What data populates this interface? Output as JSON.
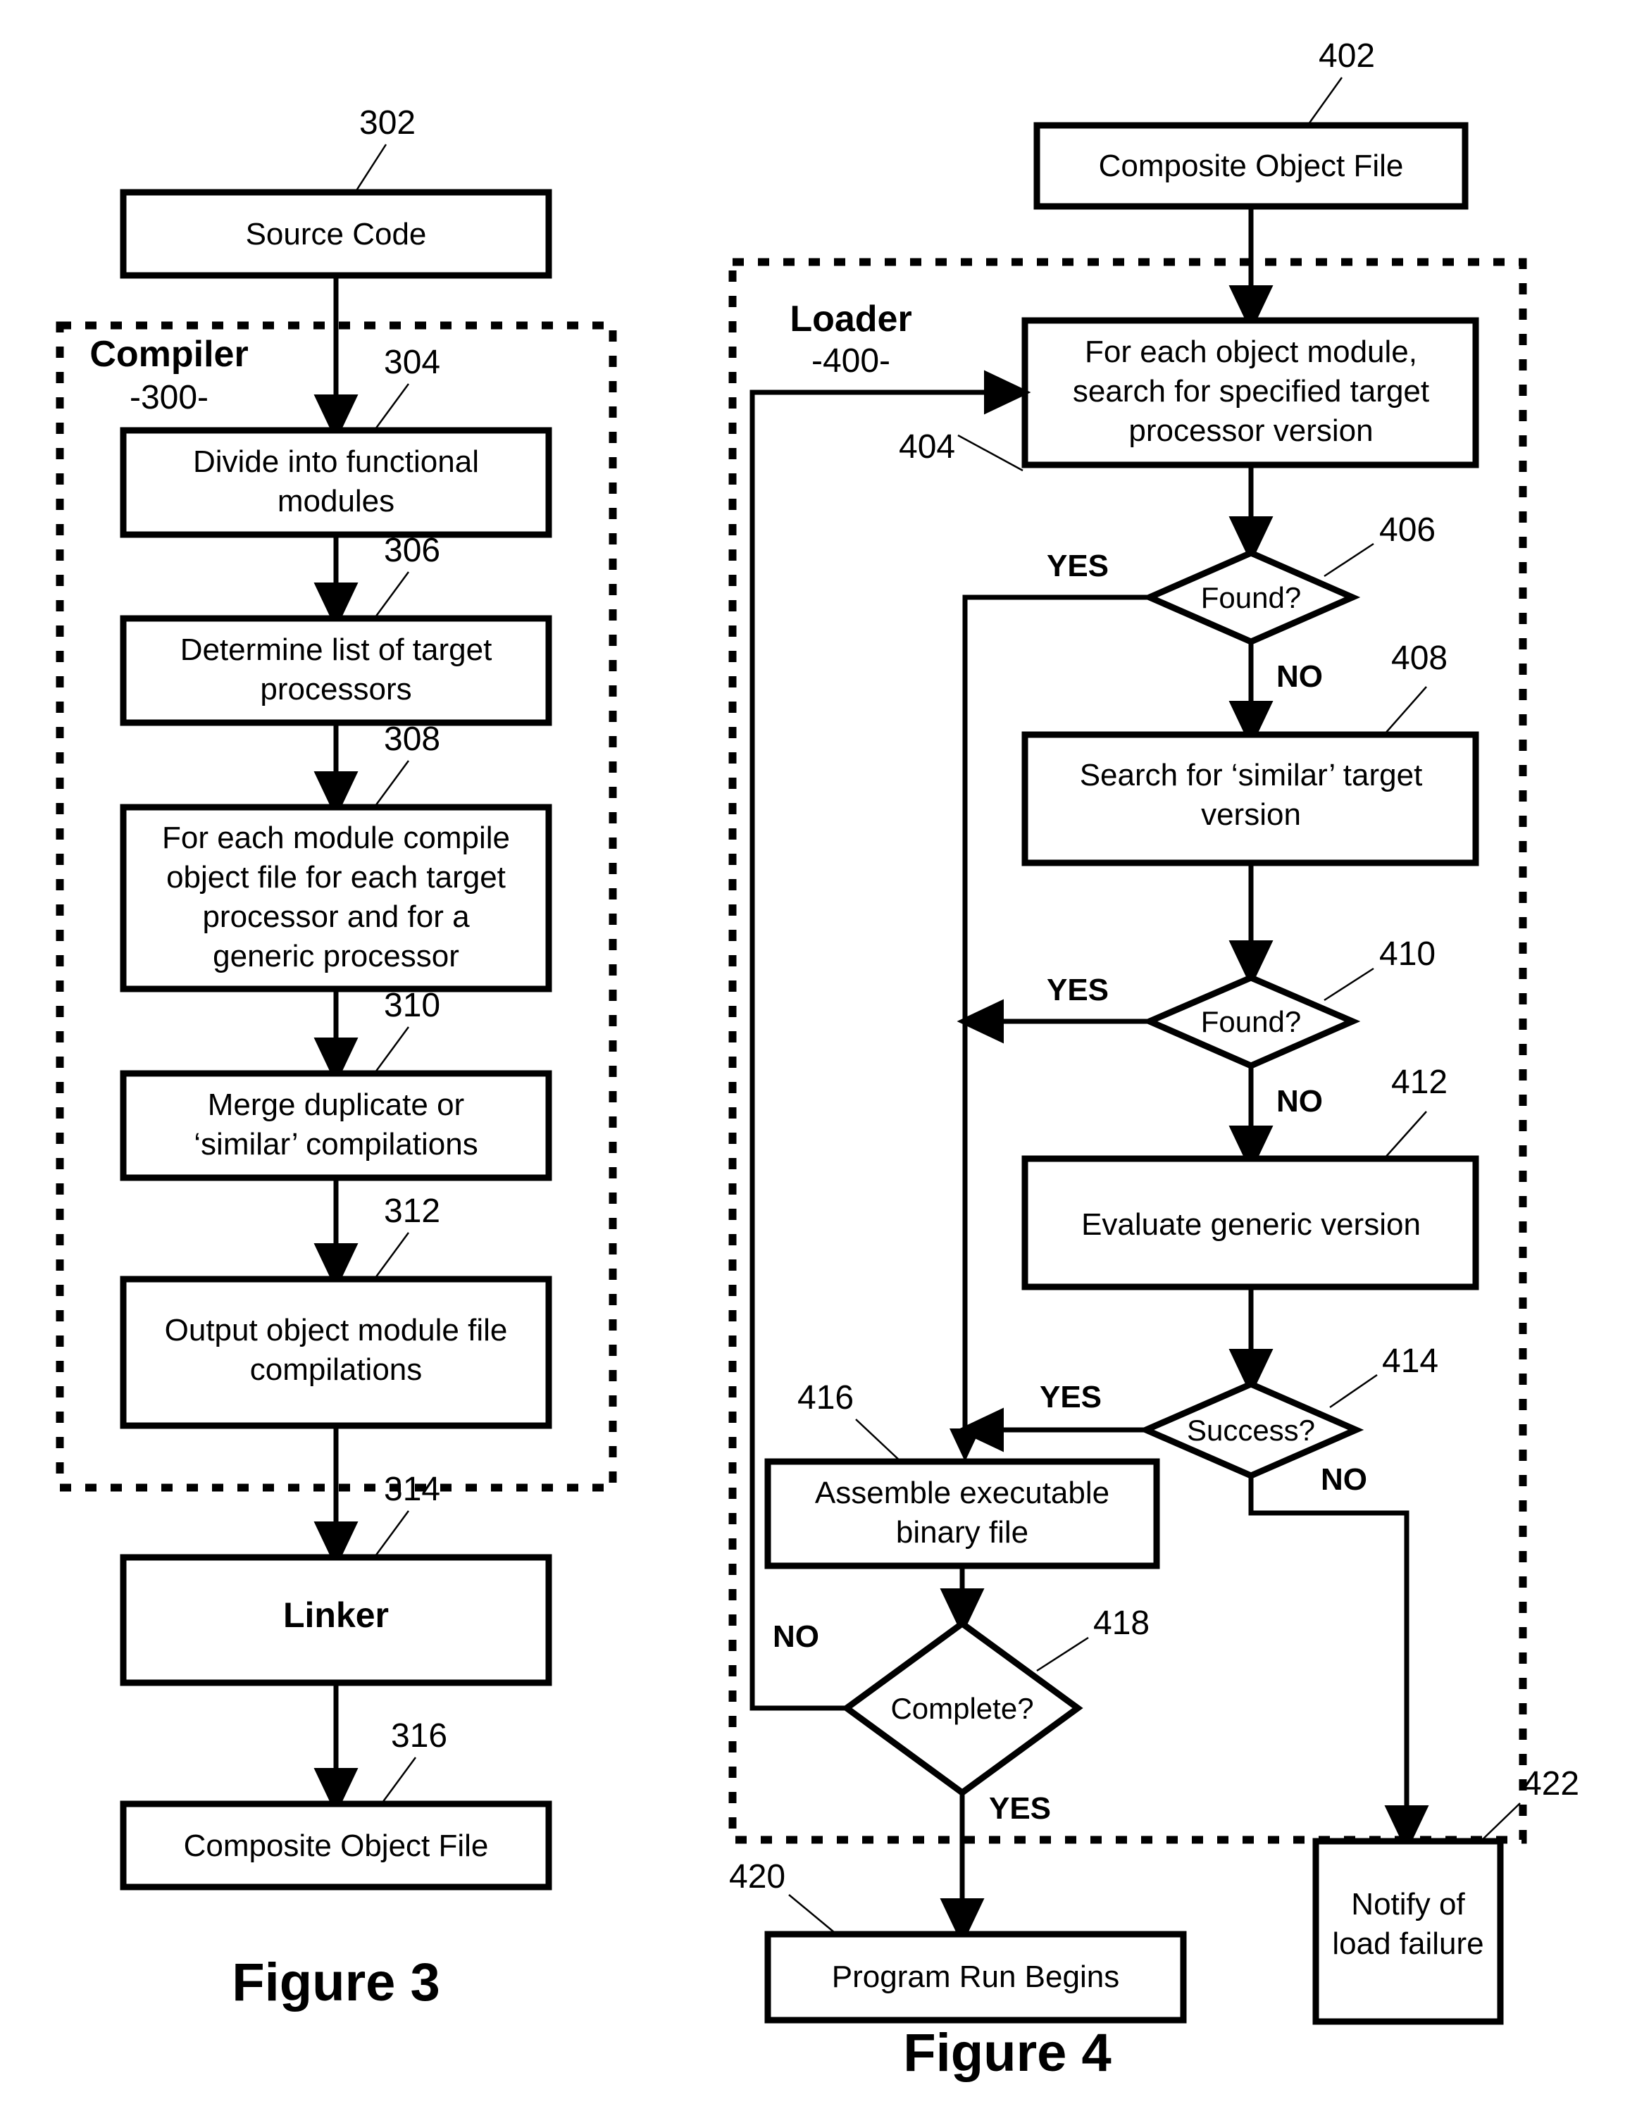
{
  "sheet": {
    "background_color": "#ffffff",
    "ink_color": "#000000"
  },
  "figure3": {
    "caption": "Figure 3",
    "group": {
      "title": "Compiler",
      "number": "-300-"
    },
    "nodes": [
      {
        "ref": "302",
        "label": "Source Code",
        "shape": "box",
        "bold": false
      },
      {
        "ref": "304",
        "label_line1": "Divide into functional",
        "label_line2": "modules",
        "shape": "box",
        "bold": false
      },
      {
        "ref": "306",
        "label_line1": "Determine list of target",
        "label_line2": "processors",
        "shape": "box",
        "bold": false
      },
      {
        "ref": "308",
        "label_line1": "For each module compile",
        "label_line2": "object file for each target",
        "label_line3": "processor and for a",
        "label_line4": "generic processor",
        "shape": "box",
        "bold": false
      },
      {
        "ref": "310",
        "label_line1": "Merge duplicate or",
        "label_line2": "‘similar’ compilations",
        "shape": "box",
        "bold": false
      },
      {
        "ref": "312",
        "label_line1": "Output object module file",
        "label_line2": "compilations",
        "shape": "box",
        "bold": false
      },
      {
        "ref": "314",
        "label": "Linker",
        "shape": "box",
        "bold": true
      },
      {
        "ref": "316",
        "label": "Composite Object File",
        "shape": "box",
        "bold": false
      }
    ]
  },
  "figure4": {
    "caption": "Figure 4",
    "group": {
      "title": "Loader",
      "number": "-400-"
    },
    "nodes": [
      {
        "ref": "402",
        "label": "Composite Object File",
        "shape": "box"
      },
      {
        "ref": "404",
        "label_line1": "For each object module,",
        "label_line2": "search for specified target",
        "label_line3": "processor version",
        "shape": "box"
      },
      {
        "ref": "406",
        "label": "Found?",
        "shape": "diamond"
      },
      {
        "ref": "408",
        "label_line1": "Search for ‘similar’ target",
        "label_line2": "version",
        "shape": "box"
      },
      {
        "ref": "410",
        "label": "Found?",
        "shape": "diamond"
      },
      {
        "ref": "412",
        "label": "Evaluate generic version",
        "shape": "box"
      },
      {
        "ref": "414",
        "label": "Success?",
        "shape": "diamond"
      },
      {
        "ref": "416",
        "label_line1": "Assemble executable",
        "label_line2": "binary file",
        "shape": "box"
      },
      {
        "ref": "418",
        "label": "Complete?",
        "shape": "diamond"
      },
      {
        "ref": "420",
        "label": "Program Run Begins",
        "shape": "box"
      },
      {
        "ref": "422",
        "label_line1": "Notify of",
        "label_line2": "load failure",
        "shape": "box"
      }
    ],
    "branch_labels": {
      "found406_yes": "YES",
      "found406_no": "NO",
      "found410_yes": "YES",
      "found410_no": "NO",
      "success414_yes": "YES",
      "success414_no": "NO",
      "complete418_no": "NO",
      "complete418_yes": "YES"
    }
  }
}
